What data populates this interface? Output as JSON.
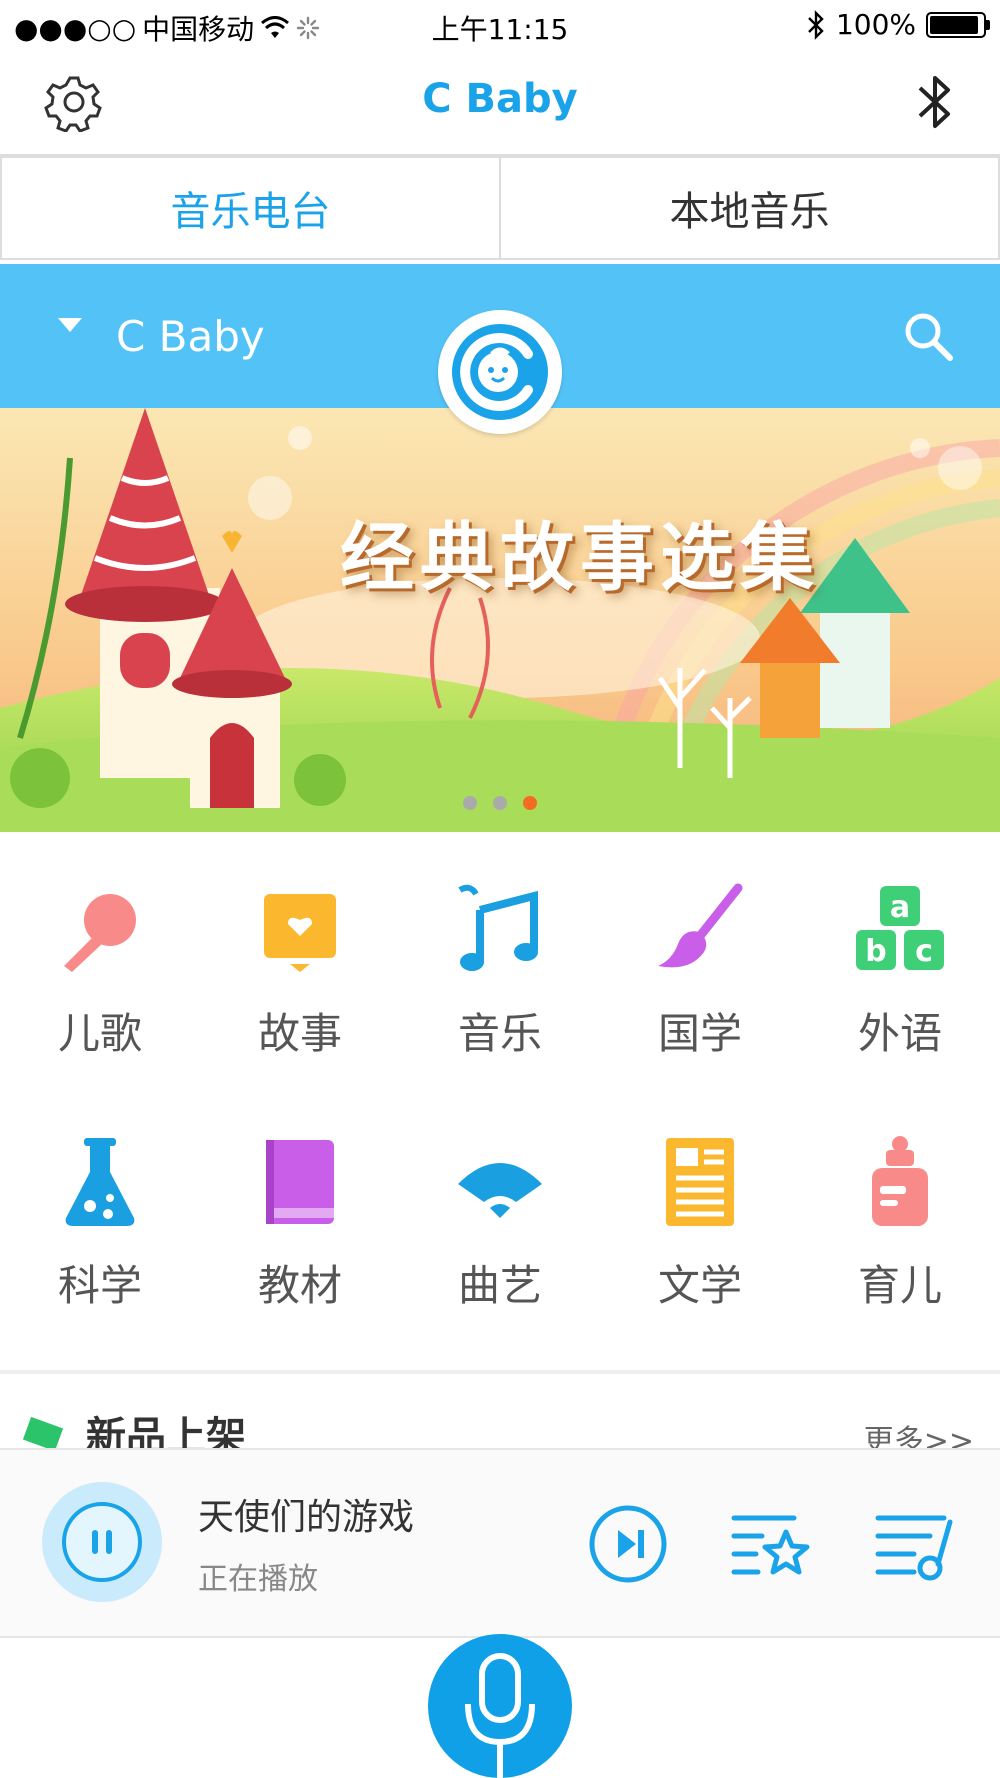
{
  "status_bar": {
    "signal": "●●●○○",
    "carrier": "中国移动",
    "time": "上午11:15",
    "battery": "100%",
    "battery_level": 1.0
  },
  "nav": {
    "title": "C Baby",
    "settings_icon": "gear-icon",
    "bluetooth_icon": "bluetooth-icon"
  },
  "tabs": [
    {
      "label": "音乐电台",
      "active": true
    },
    {
      "label": "本地音乐",
      "active": false
    }
  ],
  "header": {
    "selector_label": "C Baby",
    "search_icon": "search-icon"
  },
  "banner": {
    "title": "经典故事选集",
    "page_count": 3,
    "current_page": 3
  },
  "categories": [
    {
      "label": "儿歌",
      "icon": "microphone-icon",
      "color": "#f98a8a"
    },
    {
      "label": "故事",
      "icon": "storybook-icon",
      "color": "#fbb82e"
    },
    {
      "label": "音乐",
      "icon": "music-note-icon",
      "color": "#1a9fe0"
    },
    {
      "label": "国学",
      "icon": "brush-icon",
      "color": "#c95ee8"
    },
    {
      "label": "外语",
      "icon": "abc-blocks-icon",
      "color": "#3fcf76"
    },
    {
      "label": "科学",
      "icon": "flask-icon",
      "color": "#1a9fe0"
    },
    {
      "label": "教材",
      "icon": "textbook-icon",
      "color": "#c95ee8"
    },
    {
      "label": "曲艺",
      "icon": "fan-icon",
      "color": "#1a9fe0"
    },
    {
      "label": "文学",
      "icon": "document-icon",
      "color": "#fbb82e"
    },
    {
      "label": "育儿",
      "icon": "baby-bottle-icon",
      "color": "#f98a8a"
    }
  ],
  "new_section": {
    "title": "新品上架",
    "more": "更多>>"
  },
  "player": {
    "song": "天使们的游戏",
    "state": "正在播放"
  },
  "colors": {
    "accent": "#1aa3e8",
    "header_bg": "#53c3f7",
    "active_dot": "#f36c21"
  }
}
